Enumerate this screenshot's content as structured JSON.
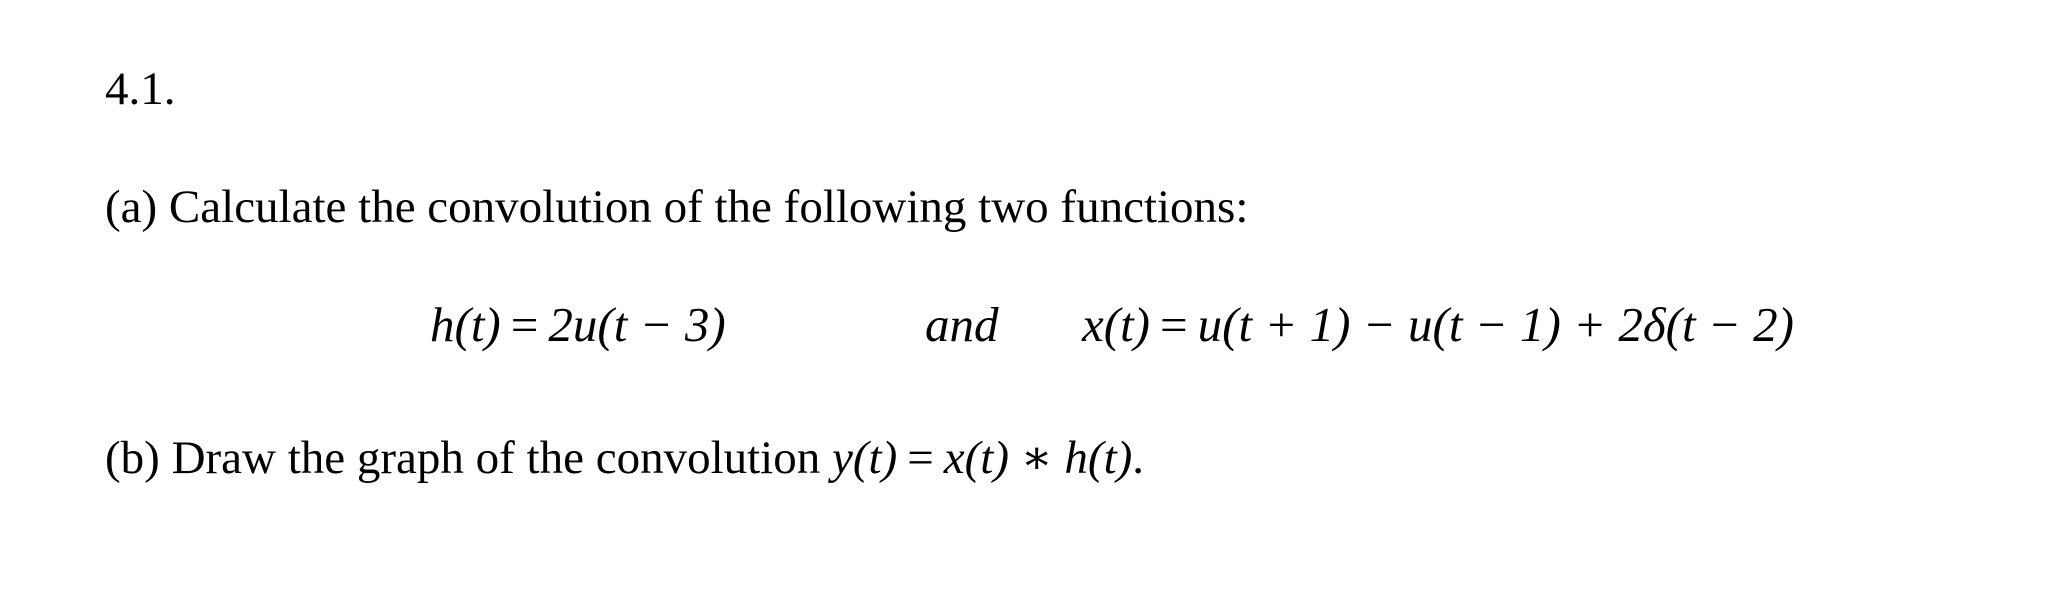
{
  "problem": {
    "number": "4.1.",
    "part_a": {
      "label": "(a)",
      "text": "Calculate the convolution of the following two functions:"
    },
    "equations": {
      "h": {
        "lhs": "h(t)",
        "equals": "=",
        "rhs": "2u(t − 3)"
      },
      "conjunction": "and",
      "x": {
        "lhs": "x(t)",
        "equals": "=",
        "rhs": "u(t + 1) − u(t − 1) + 2δ(t − 2)"
      }
    },
    "part_b": {
      "label": "(b)",
      "text": "Draw the graph of the convolution",
      "equation_lhs": "y(t)",
      "equals": "=",
      "equation_rhs": "x(t) ∗ h(t)",
      "end": "."
    }
  }
}
